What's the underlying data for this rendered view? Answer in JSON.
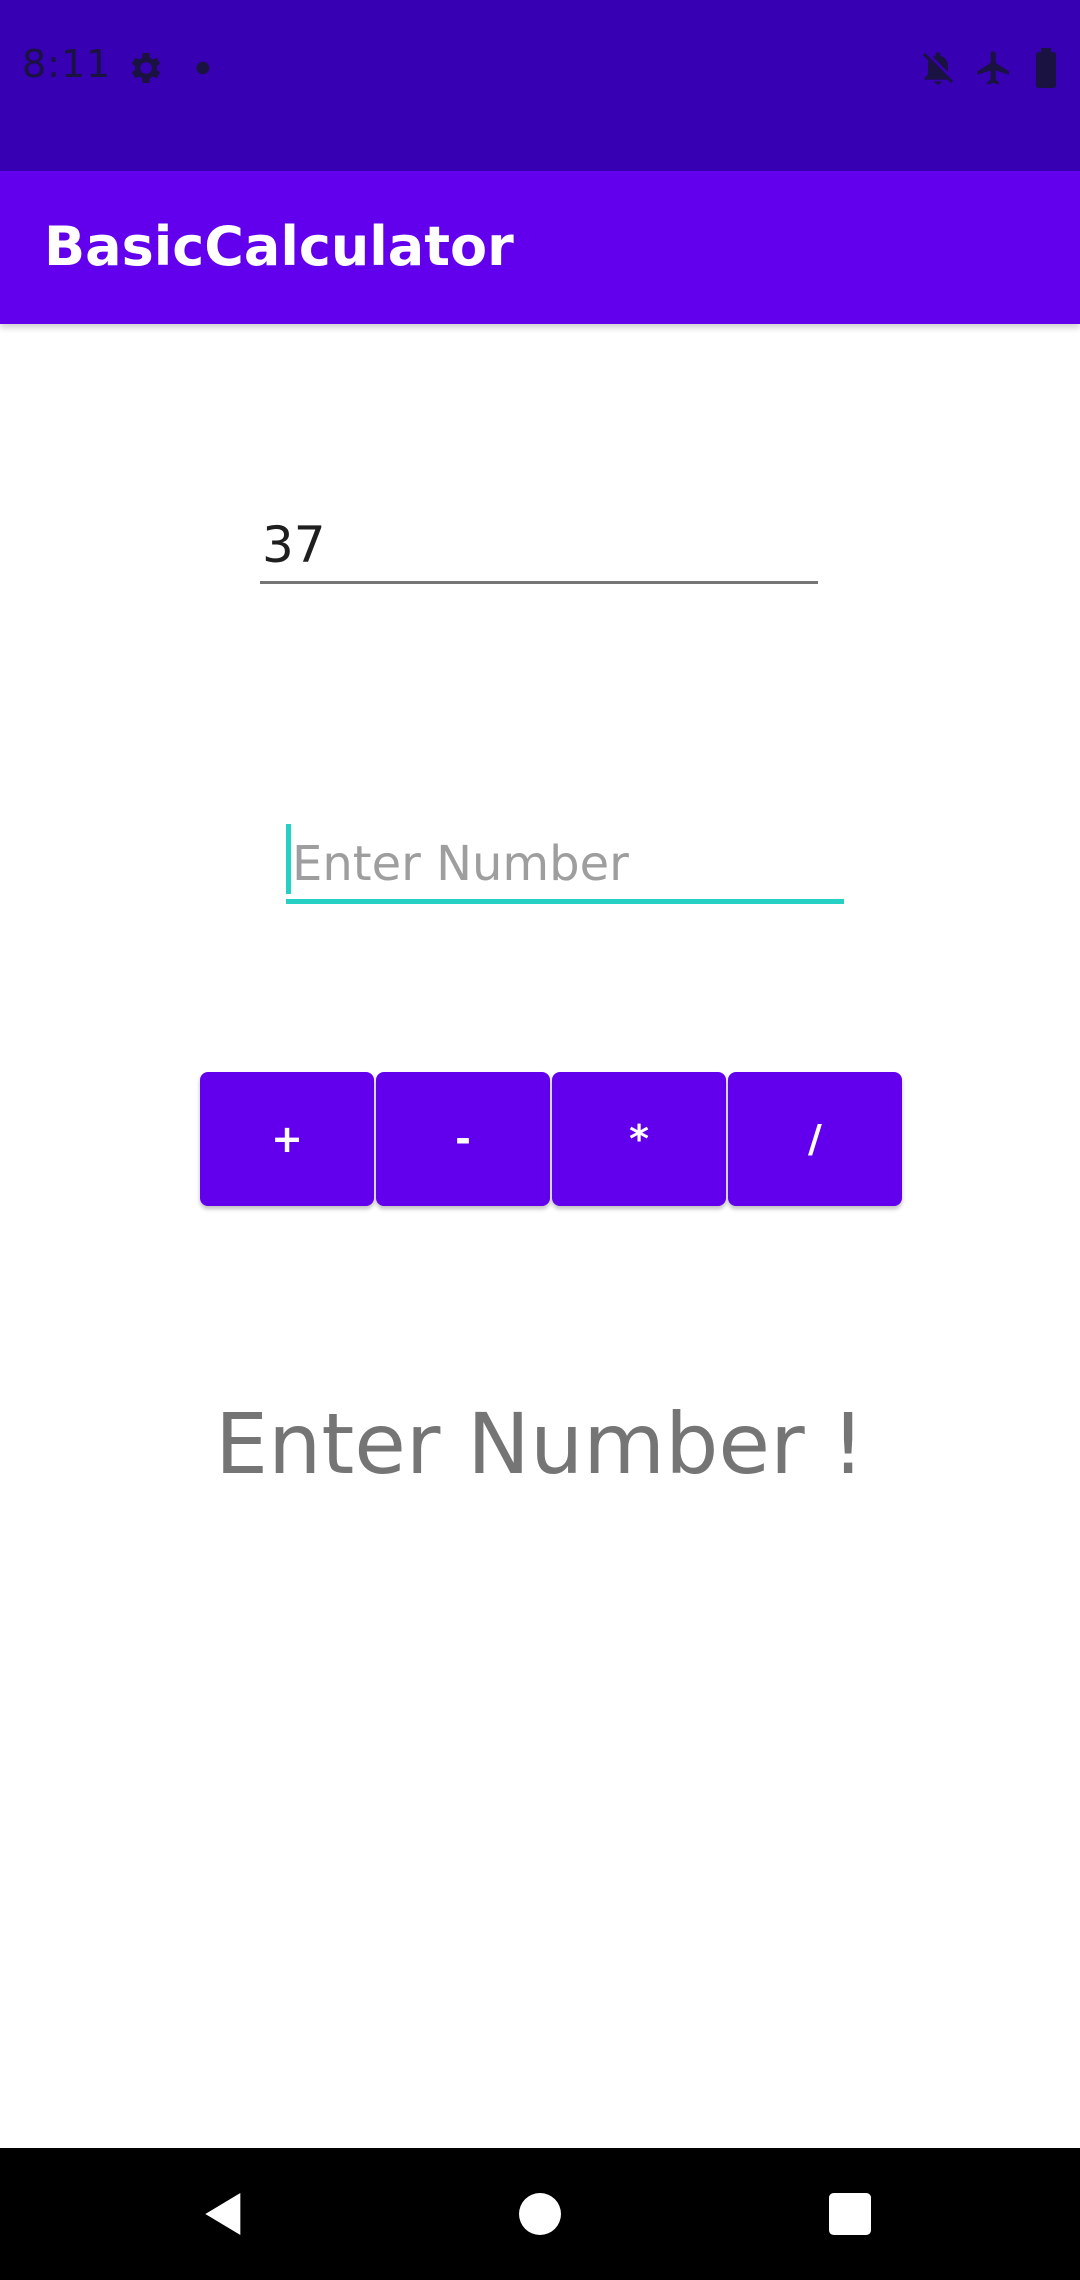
{
  "status_bar": {
    "time": "8:11",
    "icons": [
      "gear-icon",
      "dot-icon",
      "bell-off-icon",
      "airplane-icon",
      "battery-icon"
    ],
    "background": "#3700b3"
  },
  "app_bar": {
    "title": "BasicCalculator",
    "background": "#6200ee"
  },
  "inputs": {
    "first_value": "37",
    "second_placeholder": "Enter Number",
    "focus_color": "#26d0c2"
  },
  "operators": {
    "add": "+",
    "subtract": "-",
    "multiply": "*",
    "divide": "/"
  },
  "result": {
    "text": "Enter Number !"
  },
  "nav_bar": {
    "icons": [
      "back-icon",
      "home-icon",
      "recents-icon"
    ]
  }
}
